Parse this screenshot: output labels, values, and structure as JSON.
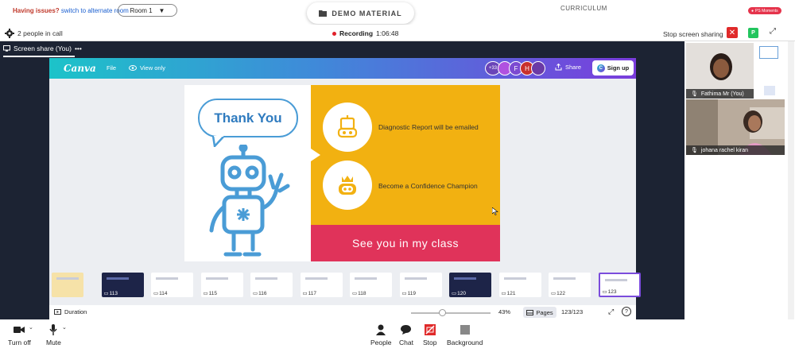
{
  "topbar": {
    "issues_label": "Having issues?",
    "alt_room_link": "switch to alternate room",
    "room_selected": "Room 1",
    "demo_material": "DEMO MATERIAL",
    "curriculum": "CURRICULUM",
    "moments_badge": "PS Moments"
  },
  "callbar": {
    "people_in_call": "2 people in call",
    "recording_label": "Recording",
    "recording_time": "1:06:48",
    "stop_sharing": "Stop screen sharing",
    "participant_badge": "P"
  },
  "stage": {
    "share_tab": "Screen share (You)",
    "share_tab_menu": "•••"
  },
  "canva": {
    "logo": "Canva",
    "file": "File",
    "view_only": "View only",
    "avatar_count": "+33",
    "avatars": [
      {
        "letter": "",
        "color": "#b052e0"
      },
      {
        "letter": "F",
        "color": "#7c4ad1"
      },
      {
        "letter": "H",
        "color": "#c9302c"
      },
      {
        "letter": "",
        "color": "#6b3aa6"
      }
    ],
    "share": "Share",
    "signup": "Sign up"
  },
  "slide": {
    "thank_you": "Thank You",
    "item1": "Diagnostic Report will be emailed",
    "item2": "Become a Confidence Champion",
    "footer": "See you in my class"
  },
  "thumbnails": [
    {
      "num": "",
      "dark": false
    },
    {
      "num": "113",
      "dark": true
    },
    {
      "num": "114",
      "dark": false
    },
    {
      "num": "115",
      "dark": false
    },
    {
      "num": "116",
      "dark": false
    },
    {
      "num": "117",
      "dark": false
    },
    {
      "num": "118",
      "dark": false
    },
    {
      "num": "119",
      "dark": false
    },
    {
      "num": "120",
      "dark": true
    },
    {
      "num": "121",
      "dark": false
    },
    {
      "num": "122",
      "dark": false
    },
    {
      "num": "123",
      "dark": false
    }
  ],
  "canva_footer": {
    "duration": "Duration",
    "zoom": "43%",
    "pages": "Pages",
    "page_count": "123/123",
    "help": "?"
  },
  "participants": [
    {
      "name": "Fathima Mr (You)"
    },
    {
      "name": "johana rachel kiran"
    }
  ],
  "controls": {
    "camera": "Turn off",
    "mic": "Mute",
    "people": "People",
    "chat": "Chat",
    "stop": "Stop",
    "background": "Background"
  },
  "colors": {
    "accent_red": "#e02a2a",
    "slide_yellow": "#f2b111",
    "slide_red": "#e0335a",
    "robot_blue": "#4a9cd6"
  }
}
